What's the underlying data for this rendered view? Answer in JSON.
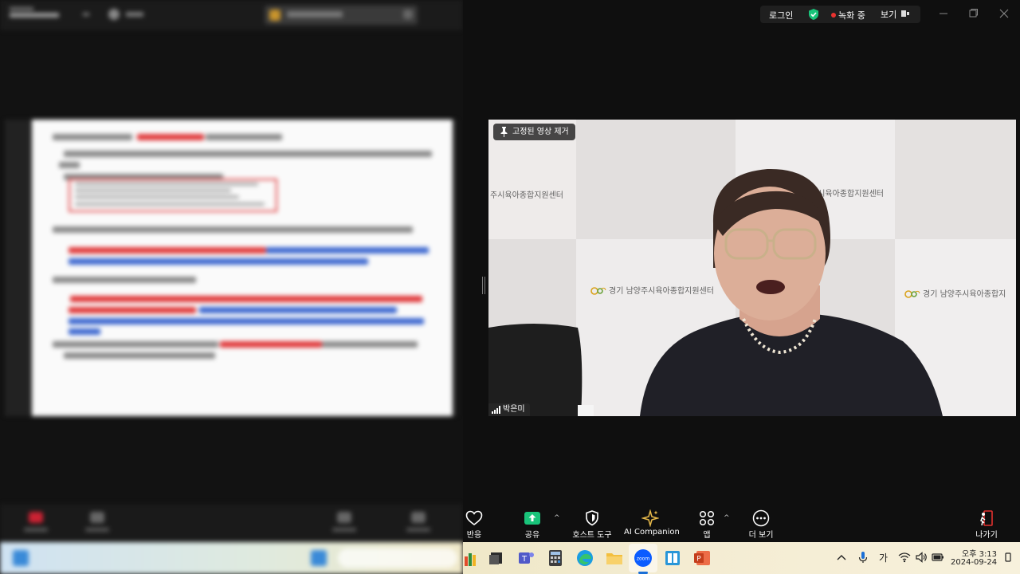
{
  "topbar": {
    "login_label": "로그인",
    "recording_label": "녹화 중",
    "view_label": "보기"
  },
  "video": {
    "pinned_label": "고정된 영상 제거",
    "participant_name": "박은미",
    "watermark_text_left": "주시육아종합지원센터",
    "watermark_text_mid": "경기 남양주시육아종합지원센터",
    "watermark_text_top": "주시육아종합지원센터",
    "watermark_text_right": "경기 남양주시육아종합지"
  },
  "toolbar": {
    "reactions_label": "반응",
    "share_label": "공유",
    "host_tools_label": "호스트 도구",
    "ai_companion_label": "AI Companion",
    "apps_label": "앱",
    "more_label": "더 보기",
    "leave_label": "나가기"
  },
  "taskbar": {
    "ime_label": "가",
    "time": "오후 3:13",
    "date": "2024-09-24"
  },
  "colors": {
    "share_green": "#19c37a",
    "recording_red": "#e8322f",
    "ai_gold": "#e7b94a",
    "leave_red": "#e2312f"
  }
}
